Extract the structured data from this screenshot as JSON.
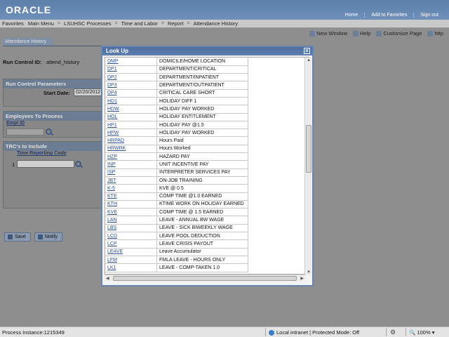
{
  "header": {
    "logo": "ORACLE",
    "links": [
      "Home",
      "Add to Favorites",
      "Sign out"
    ]
  },
  "nav": {
    "items": [
      "Favorites",
      "Main Menu",
      "LSUHSC Processes",
      "Time and Labor",
      "Report",
      "Attendance History"
    ],
    "separator": ">"
  },
  "toolbar": {
    "new_window": "New Window",
    "help": "Help",
    "customize": "Customize Page",
    "http": "http"
  },
  "page": {
    "tab": "Attendance History",
    "run_control_label": "Run Control ID:",
    "run_control_value": "attend_history",
    "run_params_title": "Run Control Parameters",
    "start_date_label": "Start Date:",
    "start_date_value": "02/20/2012",
    "employees_title": "Employees To Process",
    "empl_id_label": "Empl ID",
    "trc_title": "TRC's to Include",
    "trc_col": "Time Reporting Code",
    "trc_row_num": "1",
    "save_label": "Save",
    "notify_label": "Notify"
  },
  "lookup": {
    "title": "Look Up",
    "close": "x",
    "rows": [
      {
        "code": "DMP",
        "desc": "DOMICILE/HOME LOCATION"
      },
      {
        "code": "DP1",
        "desc": "DEPARTMENT/CRITICAL"
      },
      {
        "code": "DP2",
        "desc": "DEPARTMENT/INPATIENT"
      },
      {
        "code": "DP3",
        "desc": "DEPARTMENT/OUTPATIENT"
      },
      {
        "code": "DP4",
        "desc": "CRITICAL CARE SHORT"
      },
      {
        "code": "HD1",
        "desc": "HOLIDAY DIFF 1"
      },
      {
        "code": "HDW",
        "desc": "HOLIDAY PAY WORKED"
      },
      {
        "code": "HOL",
        "desc": "HOLIDAY ENTITLEMENT"
      },
      {
        "code": "HP1",
        "desc": "HOLIDAY PAY @1.5"
      },
      {
        "code": "HPW",
        "desc": "HOLIDAY PAY WORKED"
      },
      {
        "code": "HRPAD",
        "desc": "Hours Paid"
      },
      {
        "code": "HRWRK",
        "desc": "Hours Worked"
      },
      {
        "code": "HZP",
        "desc": "HAZARD PAY"
      },
      {
        "code": "INP",
        "desc": "UNIT INCENTIVE PAY"
      },
      {
        "code": "ISP",
        "desc": "INTERPRETER SERVICES PAY"
      },
      {
        "code": "JBT",
        "desc": "ON-JOB TRAINING"
      },
      {
        "code": "K-5",
        "desc": "KVE @ 0.5"
      },
      {
        "code": "KTE",
        "desc": "COMP TIME @1.0 EARNED"
      },
      {
        "code": "KTH",
        "desc": "KTIME WORK ON HOLIDAY EARNED"
      },
      {
        "code": "KVE",
        "desc": "COMP TIME @ 1.5 EARNED"
      },
      {
        "code": "LAN",
        "desc": "LEAVE - ANNUAL BW WAGE"
      },
      {
        "code": "LBS",
        "desc": "LEAVE - SICK BIWEEKLY WAGE"
      },
      {
        "code": "LCD",
        "desc": "LEAVE POOL DEDUCTION"
      },
      {
        "code": "LCP",
        "desc": "LEAVE CRISIS PAYOUT"
      },
      {
        "code": "LEAVE",
        "desc": "Leave Accumulator"
      },
      {
        "code": "LFM",
        "desc": "FMLA LEAVE - HOURS ONLY"
      },
      {
        "code": "LK1",
        "desc": "LEAVE -  COMP-TAKEN 1.0"
      }
    ]
  },
  "statusbar": {
    "process": "Process Instance:1215349",
    "zone": "Local intranet | Protected Mode: Off",
    "zoom": "100%"
  },
  "colors": {
    "header": "#5b7eaa",
    "modal_title": "#4d6e9e",
    "link": "#2a4f96"
  }
}
